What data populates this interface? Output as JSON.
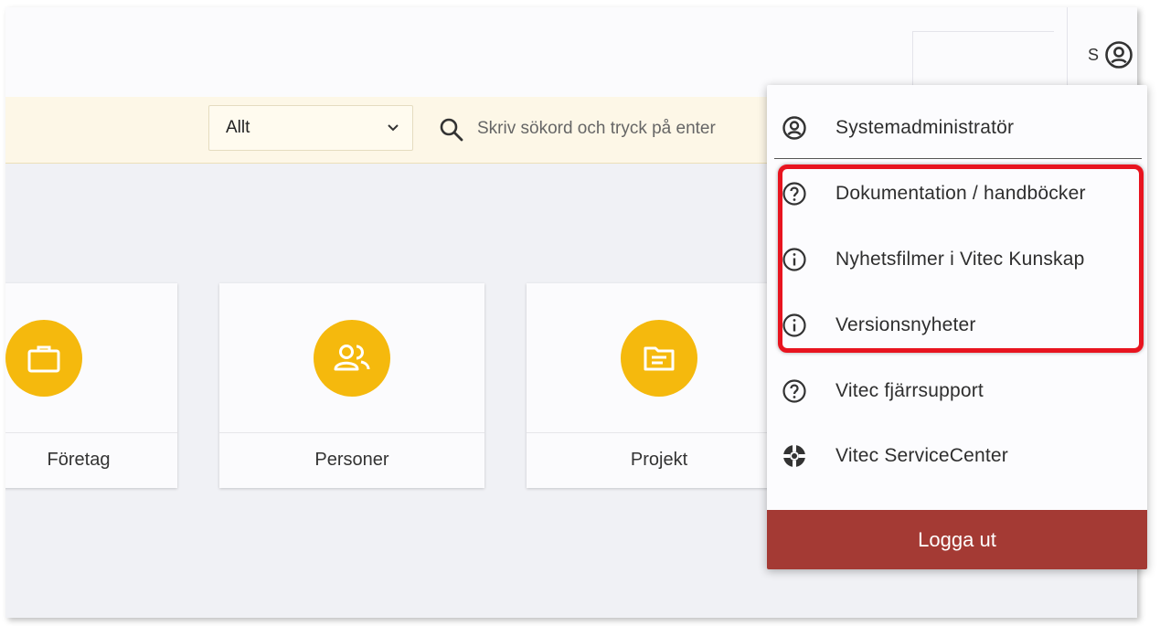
{
  "header": {
    "user_initial": "S",
    "user_icon": "user-circle-icon"
  },
  "search": {
    "scope_value": "Allt",
    "placeholder": "Skriv sökord och tryck på enter",
    "icon": "search-icon"
  },
  "tiles": [
    {
      "label": "Företag",
      "icon": "briefcase-icon"
    },
    {
      "label": "Personer",
      "icon": "users-icon"
    },
    {
      "label": "Projekt",
      "icon": "folder-icon"
    }
  ],
  "user_menu": {
    "items": [
      {
        "label": "Systemadministratör",
        "icon": "user-circle-icon"
      },
      {
        "label": "Dokumentation / handböcker",
        "icon": "help-circle-icon"
      },
      {
        "label": "Nyhetsfilmer i Vitec Kunskap",
        "icon": "info-circle-icon"
      },
      {
        "label": "Versionsnyheter",
        "icon": "info-circle-icon"
      },
      {
        "label": "Vitec fjärrsupport",
        "icon": "help-circle-icon"
      },
      {
        "label": "Vitec ServiceCenter",
        "icon": "lifebuoy-icon"
      }
    ],
    "logout_label": "Logga ut"
  },
  "colors": {
    "accent_yellow": "#f5b90d",
    "logout_red": "#a43a34",
    "highlight_red": "#e8141f",
    "searchbar_bg": "#fdf7e7"
  }
}
